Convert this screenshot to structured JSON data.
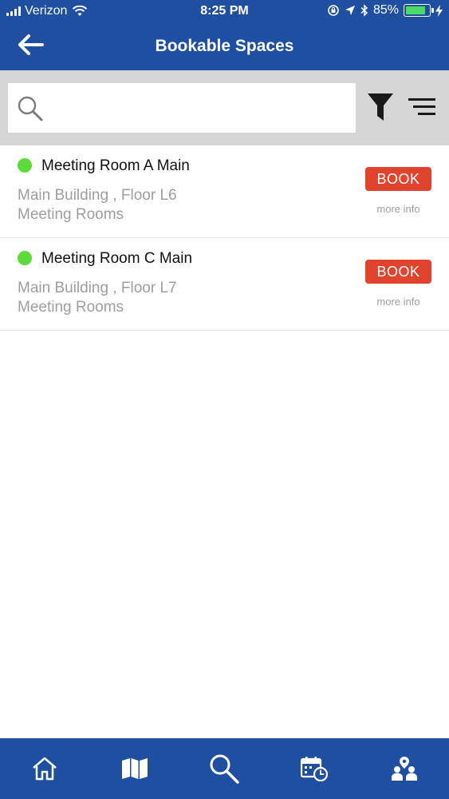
{
  "status_bar": {
    "carrier": "Verizon",
    "time": "8:25 PM",
    "battery_percent": "85%",
    "battery_level": 0.85,
    "icons": [
      "signal-icon",
      "wifi-icon",
      "screen-lock-icon",
      "location-arrow-icon",
      "bluetooth-icon",
      "battery-icon",
      "charging-icon"
    ]
  },
  "header": {
    "title": "Bookable Spaces",
    "back_icon": "back-arrow-icon"
  },
  "search": {
    "placeholder": "",
    "value": "",
    "icons": [
      "search-icon",
      "filter-icon",
      "sort-icon"
    ]
  },
  "spaces": [
    {
      "name": "Meeting Room A Main",
      "location": "Main Building , Floor L6",
      "category": "Meeting Rooms",
      "book_label": "BOOK",
      "more_info_label": "more info",
      "status_color": "#5ddb3c"
    },
    {
      "name": "Meeting Room C Main",
      "location": "Main Building , Floor L7",
      "category": "Meeting Rooms",
      "book_label": "BOOK",
      "more_info_label": "more info",
      "status_color": "#5ddb3c"
    }
  ],
  "bottom_nav": {
    "items": [
      "home-icon",
      "map-icon",
      "search-icon",
      "calendar-clock-icon",
      "people-location-icon"
    ],
    "active": "search-icon"
  },
  "colors": {
    "brand_blue": "#1f4fa0",
    "book_red": "#e0442e",
    "available_green": "#5ddb3c"
  }
}
